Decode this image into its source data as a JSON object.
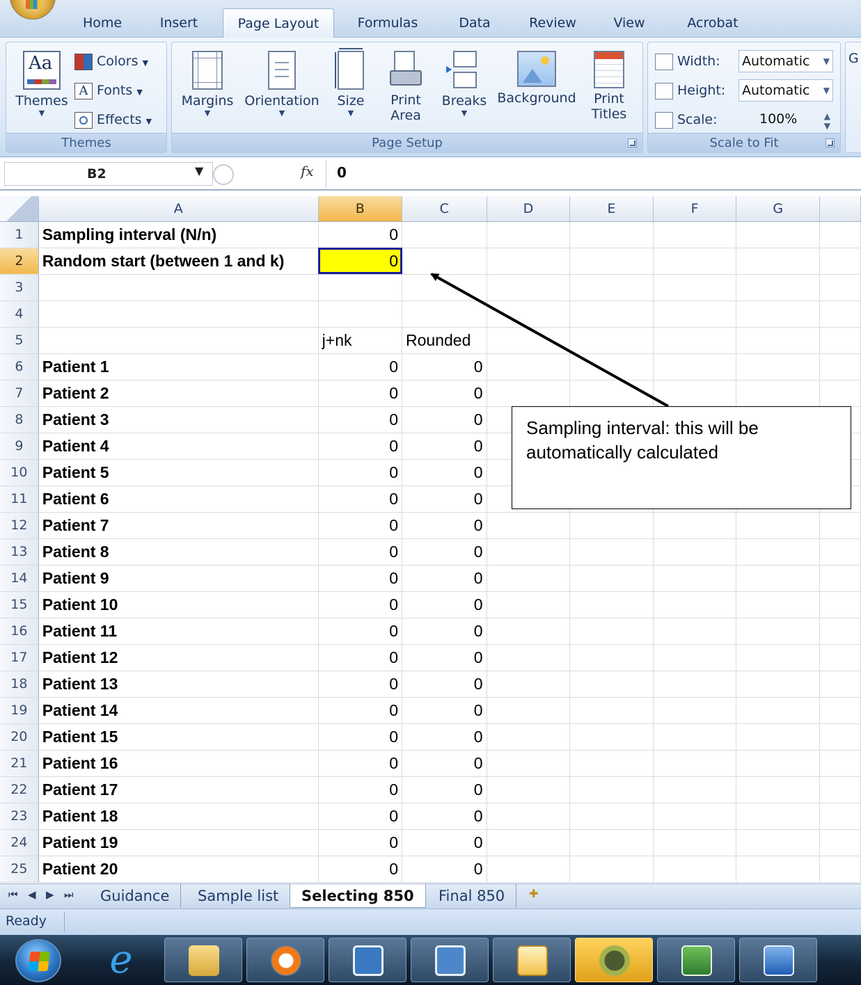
{
  "ribbon": {
    "tabs": [
      "Home",
      "Insert",
      "Page Layout",
      "Formulas",
      "Data",
      "Review",
      "View",
      "Acrobat"
    ],
    "active_tab": "Page Layout",
    "themes_group": {
      "themes_label": "Themes",
      "colors_label": "Colors",
      "fonts_label": "Fonts",
      "effects_label": "Effects",
      "group_label": "Themes"
    },
    "page_setup_group": {
      "margins_label": "Margins",
      "orientation_label": "Orientation",
      "size_label": "Size",
      "print_area_label_1": "Print",
      "print_area_label_2": "Area",
      "breaks_label": "Breaks",
      "background_label": "Background",
      "print_titles_label_1": "Print",
      "print_titles_label_2": "Titles",
      "group_label": "Page Setup"
    },
    "scale_group": {
      "width_label": "Width:",
      "width_value": "Automatic",
      "height_label": "Height:",
      "height_value": "Automatic",
      "scale_label": "Scale:",
      "scale_value": "100%",
      "group_label": "Scale to Fit"
    },
    "next_group_initial": "G"
  },
  "formula_bar": {
    "name_box": "B2",
    "fx_symbol": "fx",
    "value": "0"
  },
  "grid": {
    "columns": [
      "A",
      "B",
      "C",
      "D",
      "E",
      "F",
      "G"
    ],
    "selected_column": "B",
    "selected_row": "2",
    "rows": [
      {
        "num": "1",
        "a": "Sampling interval (N/n)",
        "b": "0",
        "c": ""
      },
      {
        "num": "2",
        "a": "Random start (between 1 and k)",
        "b": "0",
        "c": ""
      },
      {
        "num": "3",
        "a": "",
        "b": "",
        "c": ""
      },
      {
        "num": "4",
        "a": "",
        "b": "",
        "c": ""
      },
      {
        "num": "5",
        "a": "",
        "b": "j+nk",
        "c": "Rounded"
      },
      {
        "num": "6",
        "a": "Patient 1",
        "b": "0",
        "c": "0"
      },
      {
        "num": "7",
        "a": "Patient 2",
        "b": "0",
        "c": "0"
      },
      {
        "num": "8",
        "a": "Patient 3",
        "b": "0",
        "c": "0"
      },
      {
        "num": "9",
        "a": "Patient 4",
        "b": "0",
        "c": "0"
      },
      {
        "num": "10",
        "a": "Patient 5",
        "b": "0",
        "c": "0"
      },
      {
        "num": "11",
        "a": "Patient 6",
        "b": "0",
        "c": "0"
      },
      {
        "num": "12",
        "a": "Patient 7",
        "b": "0",
        "c": "0"
      },
      {
        "num": "13",
        "a": "Patient 8",
        "b": "0",
        "c": "0"
      },
      {
        "num": "14",
        "a": "Patient 9",
        "b": "0",
        "c": "0"
      },
      {
        "num": "15",
        "a": "Patient 10",
        "b": "0",
        "c": "0"
      },
      {
        "num": "16",
        "a": "Patient 11",
        "b": "0",
        "c": "0"
      },
      {
        "num": "17",
        "a": "Patient 12",
        "b": "0",
        "c": "0"
      },
      {
        "num": "18",
        "a": "Patient 13",
        "b": "0",
        "c": "0"
      },
      {
        "num": "19",
        "a": "Patient 14",
        "b": "0",
        "c": "0"
      },
      {
        "num": "20",
        "a": "Patient 15",
        "b": "0",
        "c": "0"
      },
      {
        "num": "21",
        "a": "Patient 16",
        "b": "0",
        "c": "0"
      },
      {
        "num": "22",
        "a": "Patient 17",
        "b": "0",
        "c": "0"
      },
      {
        "num": "23",
        "a": "Patient 18",
        "b": "0",
        "c": "0"
      },
      {
        "num": "24",
        "a": "Patient 19",
        "b": "0",
        "c": "0"
      },
      {
        "num": "25",
        "a": "Patient 20",
        "b": "0",
        "c": "0"
      }
    ]
  },
  "callout": {
    "text": "Sampling interval: this will be automatically calculated"
  },
  "sheet_tabs": {
    "tabs": [
      "Guidance",
      "Sample list",
      "Selecting 850",
      "Final 850"
    ],
    "active": "Selecting 850"
  },
  "status_bar": {
    "text": "Ready"
  },
  "taskbar": {
    "icons": [
      "windows-start-icon",
      "internet-explorer-icon",
      "file-explorer-icon",
      "media-player-icon",
      "sync-app-icon",
      "remote-app-icon",
      "outlook-icon",
      "security-app-icon",
      "excel-icon",
      "word-icon"
    ]
  },
  "colors": {
    "active_cell_fill": "#ffff00",
    "selection_border": "#1c1d9a",
    "header_highlight": "#f2b84c",
    "ribbon_blue": "#dde9f7"
  }
}
